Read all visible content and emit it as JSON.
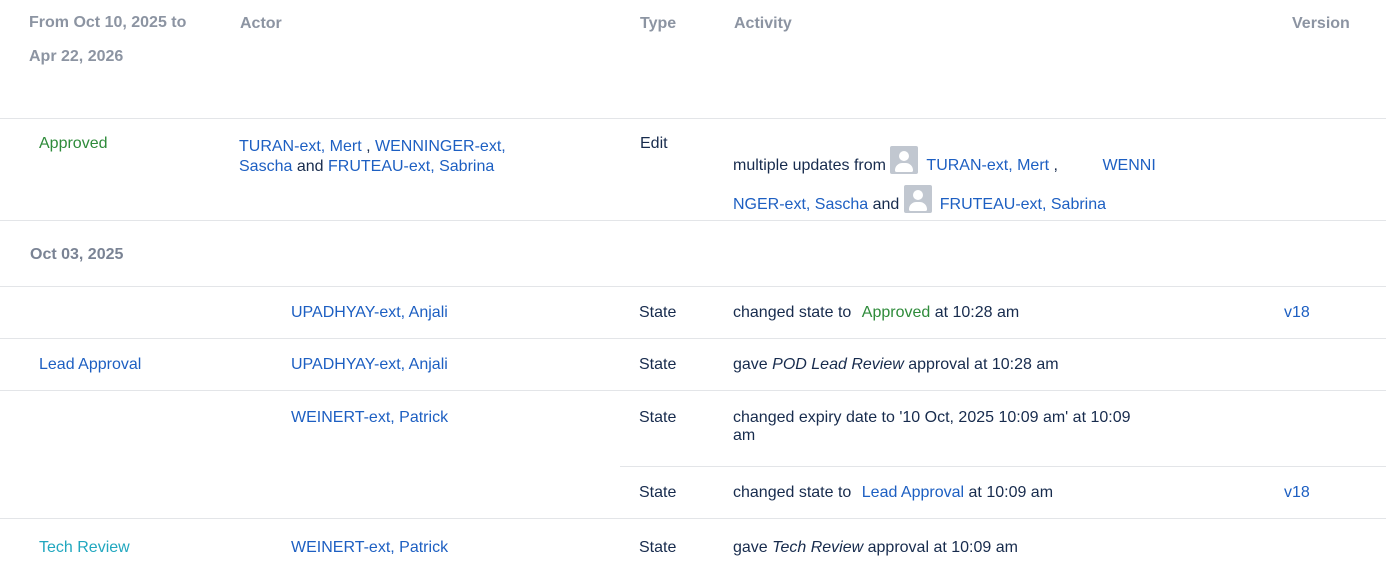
{
  "header": {
    "date_range": "From Oct 10, 2025 to Apr 22, 2026",
    "actor": "Actor",
    "type": "Type",
    "activity": "Activity",
    "version": "Version"
  },
  "group1": {
    "state": "Approved",
    "actor1": "TURAN-ext, Mert",
    "actor_sep": ",",
    "actor2_a": "WENNINGER-ext,",
    "actor2_b": "Sascha",
    "and": "and",
    "actor3": "FRUTEAU-ext, Sabrina",
    "type": "Edit",
    "activity_prefix": "multiple updates from",
    "act_actor1": "TURAN-ext, Mert",
    "act_sep": ",",
    "act_actor2_a": "WENNI",
    "act_actor2_b": "NGER-ext, Sascha",
    "act_and": "and",
    "act_actor3": "FRUTEAU-ext, Sabrina"
  },
  "date_group": "Oct 03, 2025",
  "rows": [
    {
      "state": "",
      "actor": "UPADHYAY-ext, Anjali",
      "type": "State",
      "activity_prefix": "changed state to",
      "activity_link": "Approved",
      "activity_suffix": "at 10:28 am",
      "version": "v18"
    },
    {
      "state": "Lead Approval",
      "actor": "UPADHYAY-ext, Anjali",
      "type": "State",
      "activity_prefix": "gave",
      "activity_italic": "POD Lead Review",
      "activity_suffix": "approval at 10:28 am",
      "version": ""
    },
    {
      "state": "",
      "actor": "WEINERT-ext, Patrick",
      "type": "State",
      "activity_line1": "changed expiry date to '10 Oct, 2025 10:09 am' at 10:09",
      "activity_line2": "am",
      "version": ""
    },
    {
      "state": "",
      "actor": "",
      "type": "State",
      "activity_prefix": "changed state to",
      "activity_link": "Lead Approval",
      "activity_suffix": "at 10:09 am",
      "version": "v18"
    },
    {
      "state": "Tech Review",
      "actor": "WEINERT-ext, Patrick",
      "type": "State",
      "activity_prefix": "gave",
      "activity_italic": "Tech Review",
      "activity_suffix": "approval at 10:09 am",
      "version": ""
    }
  ],
  "colors": {
    "link": "#1d5fc2",
    "approved": "#2e8b3a",
    "tech_review": "#21a7bf",
    "header": "#8c94a2"
  }
}
